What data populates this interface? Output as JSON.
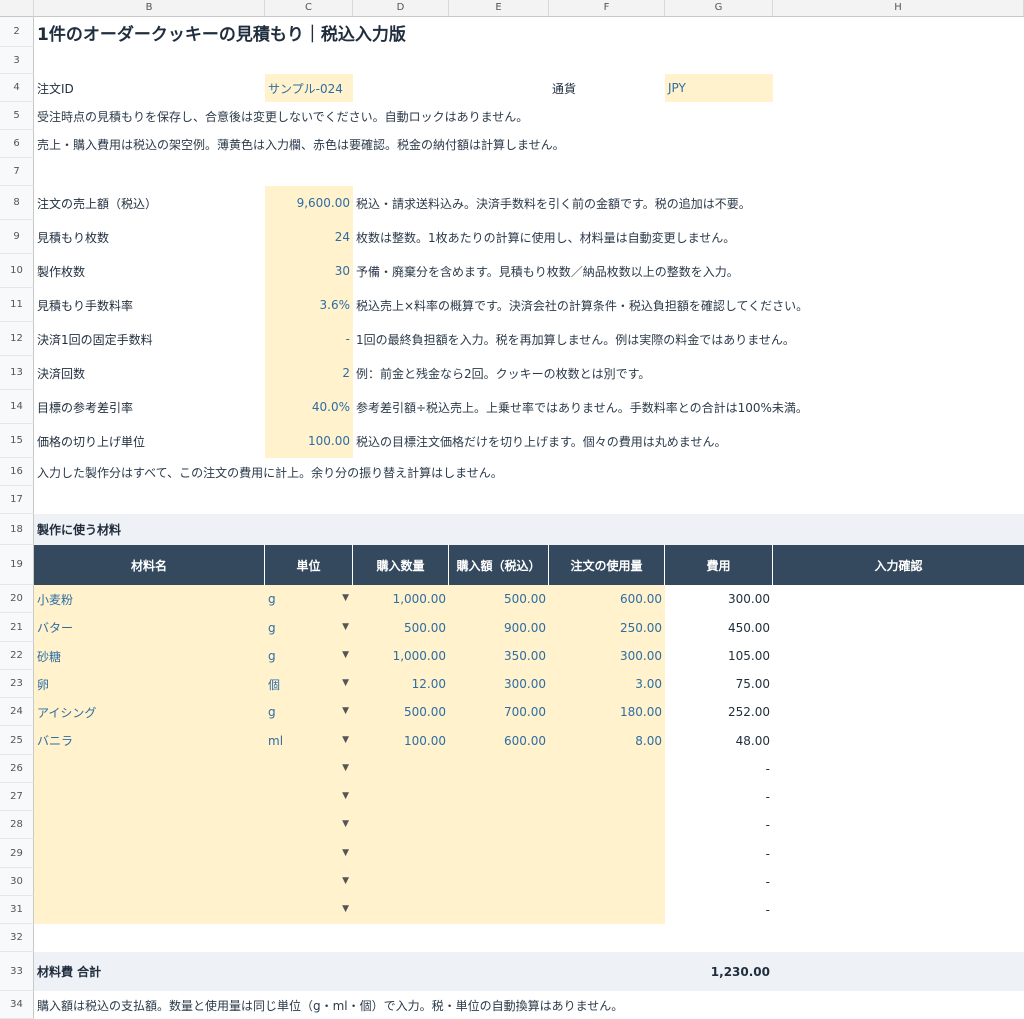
{
  "columns": [
    "B",
    "C",
    "D",
    "E",
    "F",
    "G",
    "H"
  ],
  "title": "1件のオーダークッキーの見積もり｜税込入力版",
  "order_id_label": "注文ID",
  "order_id_value": "サンプル-024",
  "currency_label": "通貨",
  "currency_value": "JPY",
  "note5": "受注時点の見積もりを保存し、合意後は変更しないでください。自動ロックはありません。",
  "note6": "売上・購入費用は税込の架空例。薄黄色は入力欄、赤色は要確認。税金の納付額は計算しません。",
  "params": [
    {
      "row": "8",
      "label": "注文の売上額（税込）",
      "value": "9,600.00",
      "note": "税込・請求送料込み。決済手数料を引く前の金額です。税の追加は不要。"
    },
    {
      "row": "9",
      "label": "見積もり枚数",
      "value": "24",
      "note": "枚数は整数。1枚あたりの計算に使用し、材料量は自動変更しません。"
    },
    {
      "row": "10",
      "label": "製作枚数",
      "value": "30",
      "note": "予備・廃棄分を含めます。見積もり枚数／納品枚数以上の整数を入力。"
    },
    {
      "row": "11",
      "label": "見積もり手数料率",
      "value": "3.6%",
      "note": "税込売上×料率の概算です。決済会社の計算条件・税込負担額を確認してください。"
    },
    {
      "row": "12",
      "label": "決済1回の固定手数料",
      "value": "-",
      "note": "1回の最終負担額を入力。税を再加算しません。例は実際の料金ではありません。"
    },
    {
      "row": "13",
      "label": "決済回数",
      "value": "2",
      "note": "例：前金と残金なら2回。クッキーの枚数とは別です。"
    },
    {
      "row": "14",
      "label": "目標の参考差引率",
      "value": "40.0%",
      "note": "参考差引額÷税込売上。上乗せ率ではありません。手数料率との合計は100%未満。"
    },
    {
      "row": "15",
      "label": "価格の切り上げ単位",
      "value": "100.00",
      "note": "税込の目標注文価格だけを切り上げます。個々の費用は丸めません。"
    }
  ],
  "note16": "入力した製作分はすべて、この注文の費用に計上。余り分の振り替え計算はしません。",
  "section_title": "製作に使う材料",
  "table_headers": [
    "材料名",
    "単位",
    "購入数量",
    "購入額（税込）",
    "注文の使用量",
    "費用",
    "入力確認"
  ],
  "materials": [
    {
      "row": "20",
      "name": "小麦粉",
      "unit": "g",
      "qty": "1,000.00",
      "price": "500.00",
      "use": "600.00",
      "cost": "300.00"
    },
    {
      "row": "21",
      "name": "バター",
      "unit": "g",
      "qty": "500.00",
      "price": "900.00",
      "use": "250.00",
      "cost": "450.00"
    },
    {
      "row": "22",
      "name": "砂糖",
      "unit": "g",
      "qty": "1,000.00",
      "price": "350.00",
      "use": "300.00",
      "cost": "105.00"
    },
    {
      "row": "23",
      "name": "卵",
      "unit": "個",
      "qty": "12.00",
      "price": "300.00",
      "use": "3.00",
      "cost": "75.00"
    },
    {
      "row": "24",
      "name": "アイシング",
      "unit": "g",
      "qty": "500.00",
      "price": "700.00",
      "use": "180.00",
      "cost": "252.00"
    },
    {
      "row": "25",
      "name": "バニラ",
      "unit": "ml",
      "qty": "100.00",
      "price": "600.00",
      "use": "8.00",
      "cost": "48.00"
    },
    {
      "row": "26",
      "name": "",
      "unit": "",
      "qty": "",
      "price": "",
      "use": "",
      "cost": "-"
    },
    {
      "row": "27",
      "name": "",
      "unit": "",
      "qty": "",
      "price": "",
      "use": "",
      "cost": "-"
    },
    {
      "row": "28",
      "name": "",
      "unit": "",
      "qty": "",
      "price": "",
      "use": "",
      "cost": "-"
    },
    {
      "row": "29",
      "name": "",
      "unit": "",
      "qty": "",
      "price": "",
      "use": "",
      "cost": "-"
    },
    {
      "row": "30",
      "name": "",
      "unit": "",
      "qty": "",
      "price": "",
      "use": "",
      "cost": "-"
    },
    {
      "row": "31",
      "name": "",
      "unit": "",
      "qty": "",
      "price": "",
      "use": "",
      "cost": "-"
    }
  ],
  "dropdown_glyph": "▼",
  "total_label": "材料費 合計",
  "total_value": "1,230.00",
  "note34": "購入額は税込の支払額。数量と使用量は同じ単位（g・ml・個）で入力。税・単位の自動換算はありません。"
}
